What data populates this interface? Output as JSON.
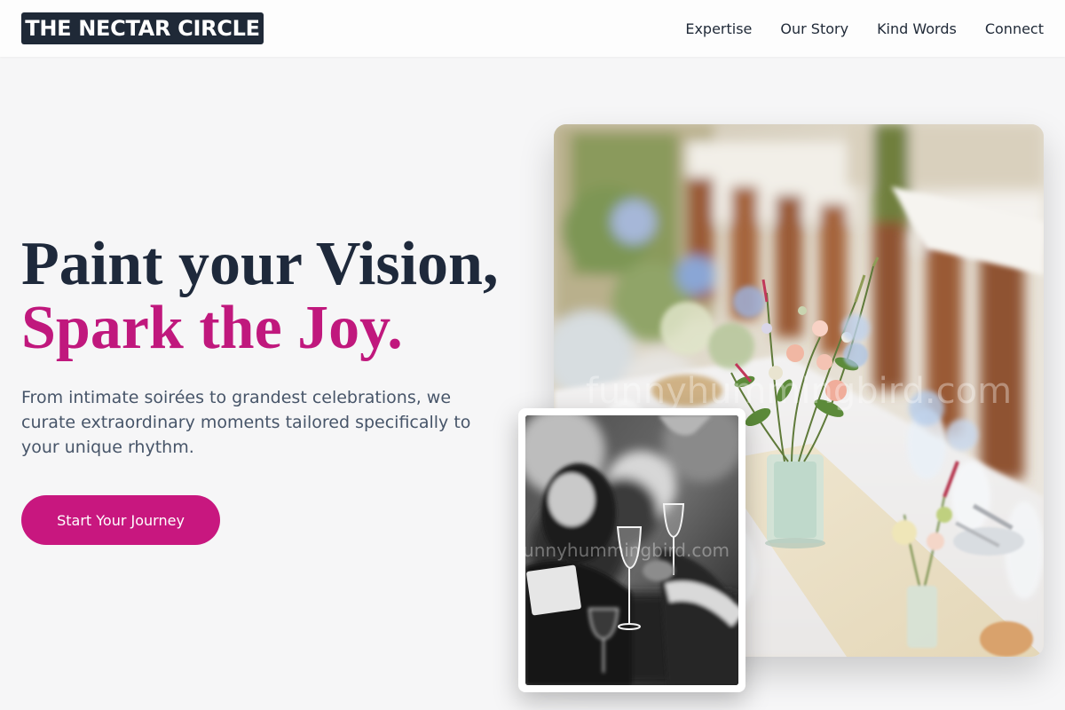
{
  "brand": {
    "name": "THE NECTAR CIRCLE"
  },
  "nav": {
    "items": [
      {
        "label": "Expertise"
      },
      {
        "label": "Our Story"
      },
      {
        "label": "Kind Words"
      },
      {
        "label": "Connect"
      }
    ]
  },
  "hero": {
    "headline_line1": "Paint your Vision,",
    "headline_line2": "Spark the Joy.",
    "subcopy": "From intimate soirées to grandest celebrations, we curate extraordinary moments tailored specifically to your unique rhythm.",
    "cta_label": "Start Your Journey"
  },
  "images": {
    "main_watermark": "funnyhummingbird.com",
    "secondary_watermark": "funnyhummingbird.com"
  },
  "colors": {
    "accent": "#c8177f",
    "dark": "#1f2937",
    "background": "#f6f6f7"
  }
}
